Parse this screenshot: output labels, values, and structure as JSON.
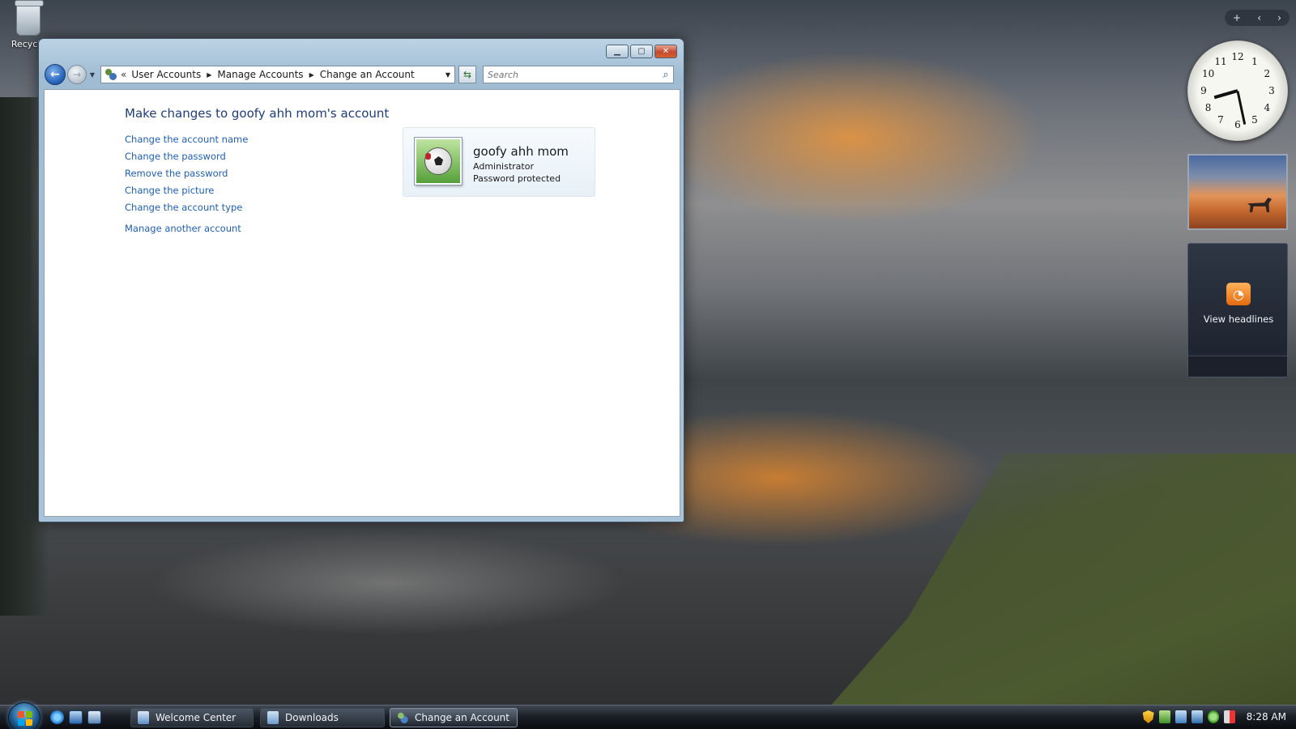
{
  "desktop": {
    "icons": [
      {
        "label": "Recycle",
        "icon": "recycle-bin-icon"
      }
    ]
  },
  "window": {
    "title": "Change an Account",
    "caption_buttons": [
      "minimize",
      "maximize",
      "close"
    ],
    "breadcrumb": [
      "User Accounts",
      "Manage Accounts",
      "Change an Account"
    ],
    "search": {
      "placeholder": "Search"
    },
    "page_title": "Make changes to goofy ahh mom's account",
    "tasks": [
      "Change the account name",
      "Change the password",
      "Remove the password",
      "Change the picture",
      "Change the account type"
    ],
    "extra_link": "Manage another account",
    "account": {
      "name": "goofy ahh mom",
      "type": "Administrator",
      "status": "Password protected",
      "picture_icon": "soccer-ball-icon"
    }
  },
  "sidebar": {
    "clock": {
      "time": "8:28",
      "numerals": [
        "12",
        "1",
        "2",
        "3",
        "4",
        "5",
        "6",
        "7",
        "8",
        "9",
        "10",
        "11"
      ]
    },
    "slideshow": {
      "icon": "oryx-desert-photo"
    },
    "feed": {
      "label": "View headlines",
      "icon": "rss-icon"
    }
  },
  "taskbar": {
    "quick_launch": [
      "ie-icon",
      "show-desktop-icon",
      "switch-windows-icon"
    ],
    "tasks": [
      {
        "label": "Welcome Center",
        "icon": "welcome-icon"
      },
      {
        "label": "Downloads",
        "icon": "folder-icon"
      },
      {
        "label": "Change an Account",
        "icon": "users-icon",
        "active": true
      }
    ],
    "clock": "8:28 AM"
  },
  "colors": {
    "link": "#1e5fb3",
    "title": "#1e3d7a",
    "taskbar": "#1b1f26"
  }
}
